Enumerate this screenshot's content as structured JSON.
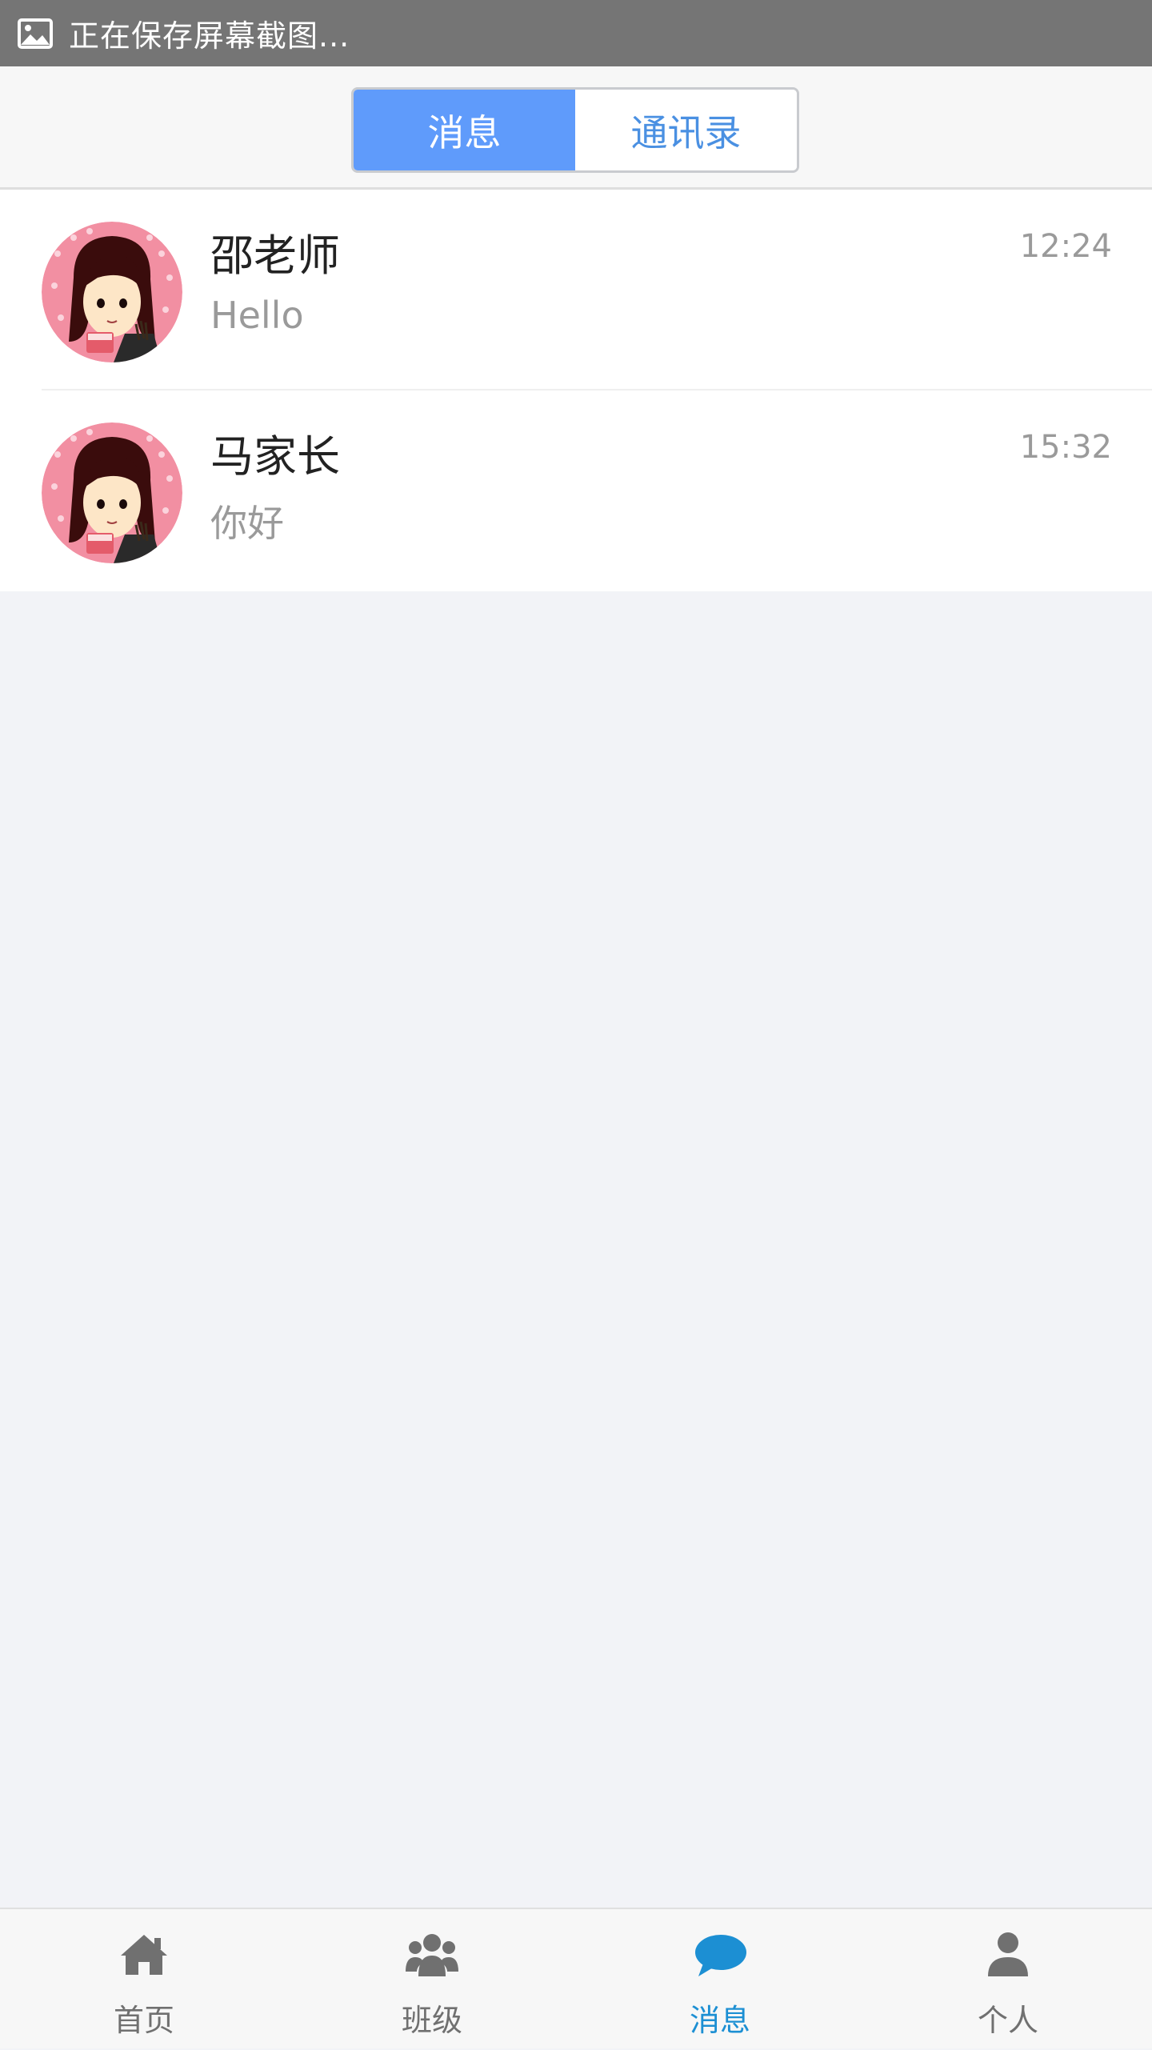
{
  "status_bar": {
    "text": "正在保存屏幕截图...",
    "icon": "image-icon"
  },
  "segment": {
    "messages_label": "消息",
    "contacts_label": "通讯录",
    "active": "messages",
    "active_color": "#5f9bfb"
  },
  "conversations": [
    {
      "name": "邵老师",
      "preview": "Hello",
      "time": "12:24",
      "avatar": "girl-avatar"
    },
    {
      "name": "马家长",
      "preview": "你好",
      "time": "15:32",
      "avatar": "girl-avatar"
    }
  ],
  "tabbar": {
    "active_color": "#1c8fd3",
    "items": [
      {
        "label": "首页",
        "icon": "home-icon"
      },
      {
        "label": "班级",
        "icon": "group-icon"
      },
      {
        "label": "消息",
        "icon": "chat-icon",
        "active": true
      },
      {
        "label": "个人",
        "icon": "person-icon"
      }
    ]
  }
}
